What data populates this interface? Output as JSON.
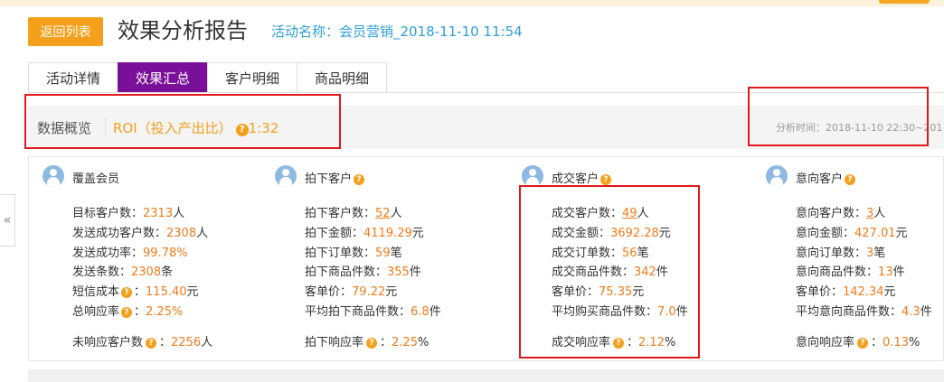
{
  "header": {
    "back_label": "返回列表",
    "title": "效果分析报告",
    "activity": "活动名称：会员营销_2018-11-10 11:54"
  },
  "tabs": [
    "活动详情",
    "效果汇总",
    "客户明细",
    "商品明细"
  ],
  "active_tab": "效果汇总",
  "overview": {
    "label": "数据概览",
    "roi_label": "ROI（投入产出比）",
    "roi_value": "1:32",
    "analysis_time": "分析时间：2018-11-10 22:30~201"
  },
  "collapse_label": "«",
  "columns": [
    {
      "title": "覆盖会员",
      "help": false,
      "stats": [
        {
          "label": "目标客户数：",
          "value": "2313",
          "unit": "人"
        },
        {
          "label": "发送成功客户数：",
          "value": "2308",
          "unit": "人"
        },
        {
          "label": "发送成功率：",
          "value": "99.78",
          "unit": "%"
        },
        {
          "label": "发送条数：",
          "value": "2308",
          "unit": "条"
        },
        {
          "label": "短信成本",
          "help": true,
          "sep": "：",
          "value": "115.40",
          "unit": "元"
        },
        {
          "label": "总响应率",
          "help": true,
          "sep": "：",
          "value": "2.25",
          "unit": "%"
        }
      ],
      "footer": {
        "label": "未响应客户数",
        "help": true,
        "sep": "：",
        "value": "2256",
        "unit": "人"
      }
    },
    {
      "title": "拍下客户",
      "help": true,
      "stats": [
        {
          "label": "拍下客户数：",
          "value": "52",
          "unit": "人",
          "link": true
        },
        {
          "label": "拍下金额：",
          "value": "4119.29",
          "unit": "元"
        },
        {
          "label": "拍下订单数：",
          "value": "59",
          "unit": "笔"
        },
        {
          "label": "拍下商品件数：",
          "value": "355",
          "unit": "件"
        },
        {
          "label": "客单价：",
          "value": "79.22",
          "unit": "元"
        },
        {
          "label": "平均拍下商品件数：",
          "value": "6.8",
          "unit": "件"
        }
      ],
      "footer": {
        "label": "拍下响应率",
        "help": true,
        "sep": "：",
        "value": "2.25",
        "unit": "%"
      }
    },
    {
      "title": "成交客户",
      "help": true,
      "stats": [
        {
          "label": "成交客户数：",
          "value": "49",
          "unit": "人",
          "link": true
        },
        {
          "label": "成交金额：",
          "value": "3692.28",
          "unit": "元"
        },
        {
          "label": "成交订单数：",
          "value": "56",
          "unit": "笔"
        },
        {
          "label": "成交商品件数：",
          "value": "342",
          "unit": "件"
        },
        {
          "label": "客单价：",
          "value": "75.35",
          "unit": "元"
        },
        {
          "label": "平均购买商品件数：",
          "value": "7.0",
          "unit": "件"
        }
      ],
      "footer": {
        "label": "成交响应率",
        "help": true,
        "sep": "：",
        "value": "2.12",
        "unit": "%"
      }
    },
    {
      "title": "意向客户",
      "help": true,
      "stats": [
        {
          "label": "意向客户数：",
          "value": "3",
          "unit": "人",
          "link": true
        },
        {
          "label": "意向金额：",
          "value": "427.01",
          "unit": "元"
        },
        {
          "label": "意向订单数：",
          "value": "3",
          "unit": "笔"
        },
        {
          "label": "意向商品件数：",
          "value": "13",
          "unit": "件"
        },
        {
          "label": "客单价：",
          "value": "142.34",
          "unit": "元"
        },
        {
          "label": "平均意向商品件数：",
          "value": "4.3",
          "unit": "件"
        }
      ],
      "footer": {
        "label": "意向响应率",
        "help": true,
        "sep": "：",
        "value": "0.13",
        "unit": "%"
      }
    }
  ],
  "colors": {
    "accent_orange": "#f5a01c",
    "value_orange": "#f07b1b",
    "tab_active": "#7a0f99",
    "link_blue": "#2f9fd9",
    "highlight_red": "#e0191c"
  }
}
